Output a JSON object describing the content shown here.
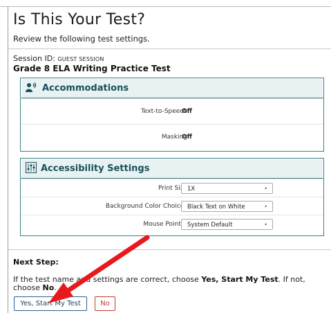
{
  "header": {
    "title": "Is This Your Test?",
    "subtitle": "Review the following test settings."
  },
  "session": {
    "label": "Session ID:",
    "id": "GUEST SESSION",
    "test_name": "Grade 8 ELA Writing Practice Test"
  },
  "accommodations": {
    "title": "Accommodations",
    "icon": "speaking-person-icon",
    "rows": [
      {
        "label": "Text-to-Speech",
        "value": "Off"
      },
      {
        "label": "Masking",
        "value": "Off"
      }
    ]
  },
  "accessibility": {
    "title": "Accessibility Settings",
    "icon": "sliders-icon",
    "rows": [
      {
        "label": "Print Size",
        "value": "1X"
      },
      {
        "label": "Background Color Choices",
        "value": "Black Text on White"
      },
      {
        "label": "Mouse Pointer",
        "value": "System Default"
      }
    ]
  },
  "next_step": {
    "heading": "Next Step:",
    "text_before": "If the test name and settings are correct, choose ",
    "yes_emphasis": "Yes, Start My Test",
    "text_middle": ". If not, choose ",
    "no_emphasis": "No",
    "text_after": "."
  },
  "buttons": {
    "yes_label": "Yes, Start My Test",
    "no_label": "No"
  },
  "colors": {
    "panel_border": "#3e7f8a",
    "panel_header_bg": "#e8f2f3",
    "panel_title": "#19505a",
    "annotation_arrow": "#e8191c",
    "no_button": "#c03a2b",
    "yes_button": "#2e5f8a"
  }
}
